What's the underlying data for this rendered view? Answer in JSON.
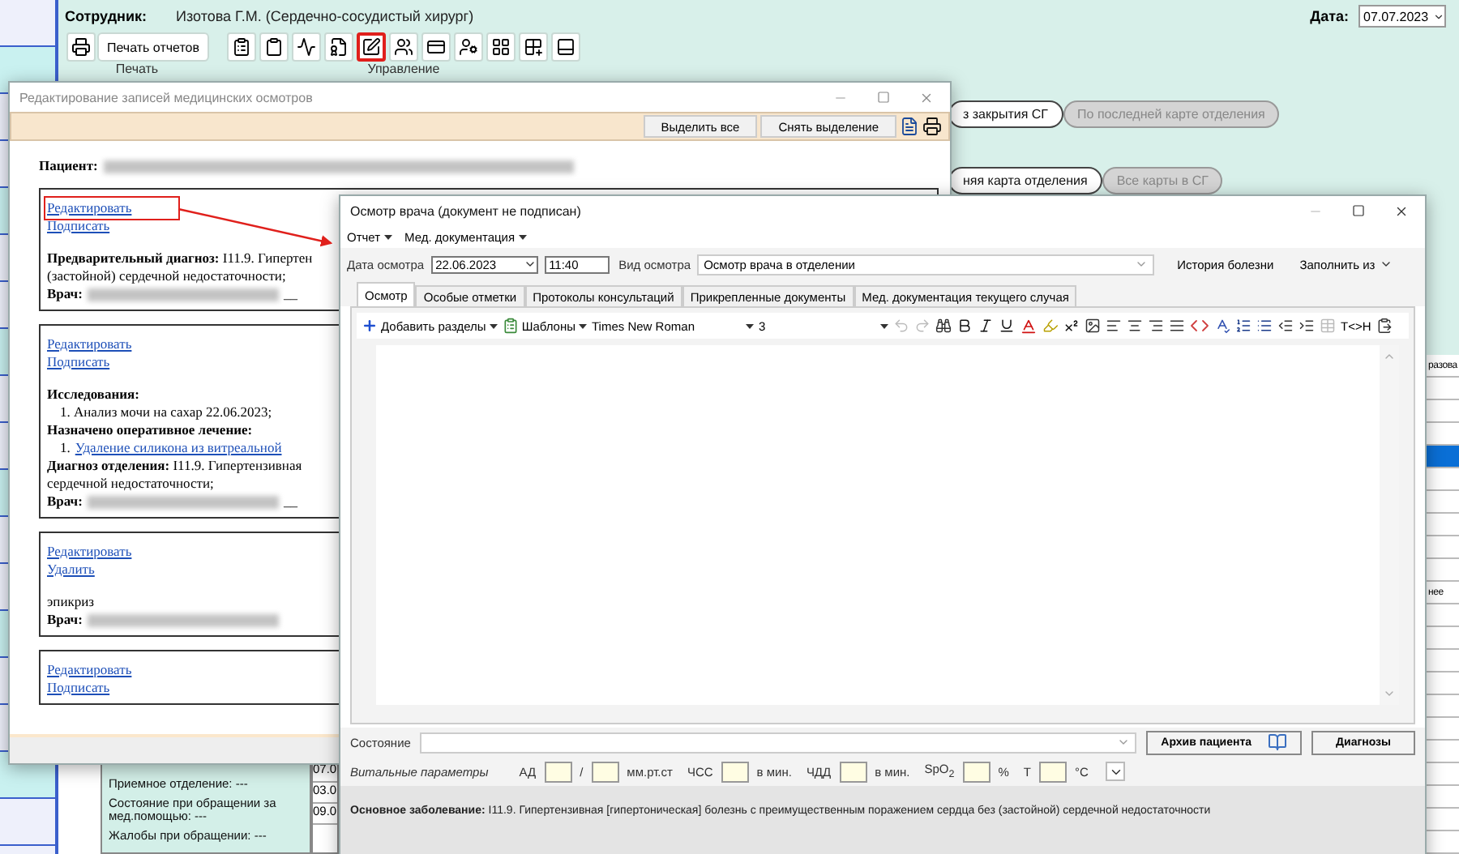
{
  "main_window": {
    "employee_label": "Сотрудник:",
    "employee": "Изотова Г.М. (Сердечно-сосудистый хирург)",
    "date_label": "Дата:",
    "date": "07.07.2023",
    "print_button": "Печать отчетов",
    "groups": [
      "Печать",
      "Управление"
    ],
    "tools": [
      {
        "highlighted": false
      },
      {
        "highlighted": false
      },
      {
        "highlighted": false
      },
      {
        "highlighted": false
      },
      {
        "highlighted": true
      },
      {
        "highlighted": false
      },
      {
        "highlighted": false
      },
      {
        "highlighted": false
      },
      {
        "highlighted": false
      },
      {
        "highlighted": false
      },
      {
        "highlighted": false
      }
    ],
    "filter_rows": [
      [
        {
          "label": "з закрытия СГ",
          "disabled": false
        },
        {
          "label": "По последней карте отделения",
          "disabled": true
        }
      ],
      [
        {
          "label": "няя карта отделения",
          "disabled": false
        },
        {
          "label": "Все карты в СГ",
          "disabled": true
        }
      ]
    ],
    "right_table_cells": [
      "разова",
      "нее"
    ],
    "date_cells": [
      "07.0",
      "03.0",
      "09.0"
    ],
    "admission_info": [
      "Приемное отделение: ---",
      "Состояние при обращении за мед.помощью: ---",
      "Жалобы при обращении: ---"
    ]
  },
  "records_dialog": {
    "title": "Редактирование записей медицинских осмотров",
    "buttons": [
      "Выделить все",
      "Снять выделение"
    ],
    "patient_label": "Пациент:",
    "records": [
      {
        "actions": [
          {
            "label": "Редактировать",
            "highlighted": true
          },
          {
            "label": "Подписать",
            "highlighted": false
          }
        ],
        "lines": [
          {
            "kind": "labeled",
            "label": "Предварительный диагноз:",
            "text": "I11.9. Гипертен"
          },
          {
            "kind": "text",
            "text": "(застойной) сердечной недостаточности;"
          },
          {
            "kind": "doctor",
            "label": "Врач:",
            "trail": "__"
          }
        ]
      },
      {
        "actions": [
          {
            "label": "Редактировать",
            "highlighted": false
          },
          {
            "label": "Подписать",
            "highlighted": false
          }
        ],
        "lines": [
          {
            "kind": "heading",
            "text": "Исследования:"
          },
          {
            "kind": "item",
            "number": "1.",
            "text": "Анализ мочи на сахар 22.06.2023;"
          },
          {
            "kind": "heading",
            "text": "Назначено оперативное лечение:"
          },
          {
            "kind": "link_item",
            "number": "1.",
            "text": "Удаление силикона из витреальной"
          },
          {
            "kind": "labeled",
            "label": "Диагноз отделения:",
            "text": "I11.9. Гипертензивная"
          },
          {
            "kind": "text",
            "text": "сердечной недостаточности;"
          },
          {
            "kind": "doctor",
            "label": "Врач:",
            "trail": "__"
          }
        ]
      },
      {
        "actions": [
          {
            "label": "Редактировать",
            "highlighted": false
          },
          {
            "label": "Удалить",
            "highlighted": false
          }
        ],
        "lines": [
          {
            "kind": "text",
            "text": "эпикриз"
          },
          {
            "kind": "doctor",
            "label": "Врач:"
          }
        ]
      },
      {
        "actions": [
          {
            "label": "Редактировать",
            "highlighted": false
          },
          {
            "label": "Подписать",
            "highlighted": false
          }
        ]
      }
    ]
  },
  "exam_window": {
    "title": "Осмотр врача (документ не подписан)",
    "menu": [
      "Отчет",
      "Мед. документация"
    ],
    "date_label": "Дата осмотра",
    "date": "22.06.2023",
    "time": "11:40",
    "type_label": "Вид осмотра",
    "type": "Осмотр врача в отделении",
    "history_button": "История болезни",
    "fill_button": "Заполнить из",
    "tabs": [
      {
        "label": "Осмотр",
        "selected": true
      },
      {
        "label": "Особые отметки",
        "selected": false
      },
      {
        "label": "Протоколы консультаций",
        "selected": false
      },
      {
        "label": "Прикрепленные документы",
        "selected": false
      },
      {
        "label": "Мед. документация текущего случая",
        "selected": false
      }
    ],
    "editor_toolbar": {
      "add_sections": "Добавить разделы",
      "templates": "Шаблоны",
      "font": "Times New Roman",
      "size": "3",
      "tag_toggle": "T<>H"
    },
    "state_label": "Состояние",
    "archive_button": "Архив пациента",
    "diagnoses_button": "Диагнозы",
    "vitals_label": "Витальные параметры",
    "vitals": [
      {
        "label": "АД",
        "unit": "/"
      },
      {
        "unit": "мм.рт.ст"
      },
      {
        "label": "ЧСС",
        "unit": "в мин."
      },
      {
        "label": "ЧДД",
        "unit": "в мин."
      },
      {
        "label": "SpO$_{2}$",
        "unit": "%"
      },
      {
        "label": "Т",
        "unit": "°C"
      }
    ],
    "main_disease_label": "Основное заболевание:",
    "main_disease": "I11.9. Гипертензивная [гипертоническая] болезнь с преимущественным поражением сердца без (застойной) сердечной недостаточности"
  }
}
